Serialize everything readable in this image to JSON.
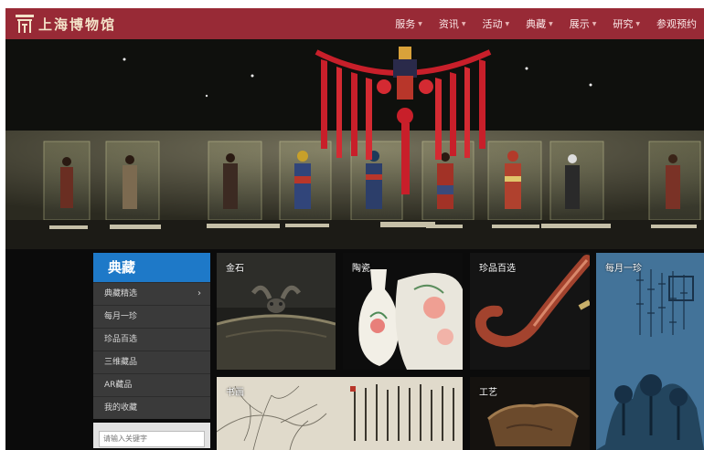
{
  "header": {
    "site_title": "上海博物馆",
    "nav": [
      {
        "label": "服务",
        "dropdown": true
      },
      {
        "label": "资讯",
        "dropdown": true
      },
      {
        "label": "活动",
        "dropdown": true
      },
      {
        "label": "典藏",
        "dropdown": true
      },
      {
        "label": "展示",
        "dropdown": true
      },
      {
        "label": "研究",
        "dropdown": true
      },
      {
        "label": "参观预约",
        "dropdown": false
      }
    ]
  },
  "side": {
    "title": "典藏",
    "items": [
      {
        "label": "典藏精选",
        "has_arrow": true
      },
      {
        "label": "每月一珍"
      },
      {
        "label": "珍品百选"
      },
      {
        "label": "三维藏品"
      },
      {
        "label": "AR藏品"
      },
      {
        "label": "我的收藏"
      }
    ],
    "search_placeholder": "请输入关键字"
  },
  "tiles": {
    "jinshi": "金石",
    "taoci": "陶瓷",
    "zhenpin": "珍品百选",
    "meiyue": "每月一珍",
    "shuhua": "书画",
    "gongyi": "工艺"
  },
  "colors": {
    "header_bg": "#982a36",
    "side_title_bg": "#1e79c8",
    "menu_bg": "#3a3a3a"
  },
  "icons": {
    "logo": "museum-logo-icon",
    "dropdown": "caret-down-icon",
    "submenu": "chevron-right-icon"
  }
}
